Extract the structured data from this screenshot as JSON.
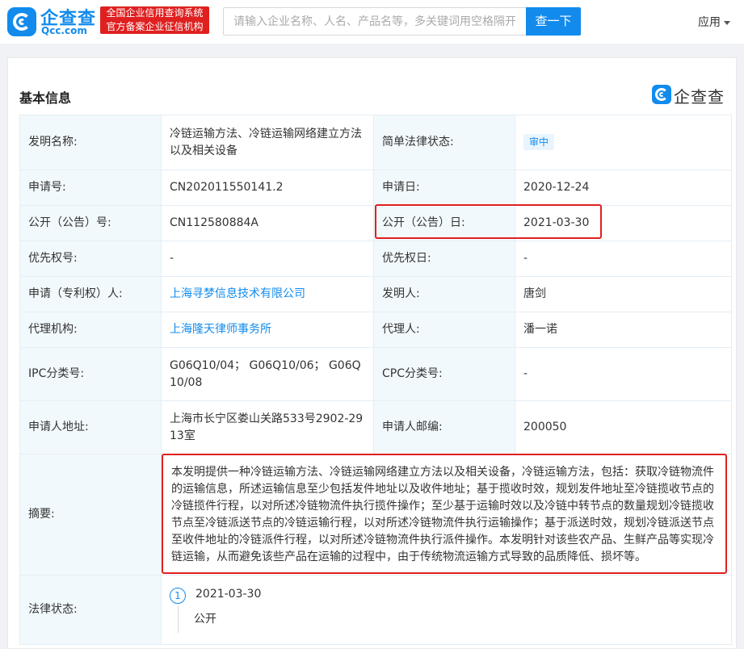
{
  "header": {
    "logo_text": "企查查",
    "logo_sub": "Qcc.com",
    "slogan_line1": "全国企业信用查询系统",
    "slogan_line2": "官方备案企业征信机构",
    "search_placeholder": "请输入企业名称、人名、产品名等，多关键词用空格隔开",
    "search_button": "查一下",
    "apps_label": "应用"
  },
  "section": {
    "title": "基本信息",
    "watermark": "企查查"
  },
  "info": {
    "invention_name_label": "发明名称:",
    "invention_name": "冷链运输方法、冷链运输网络建立方法以及相关设备",
    "legal_status_simple_label": "简单法律状态:",
    "legal_status_simple": "审中",
    "application_no_label": "申请号:",
    "application_no": "CN202011550141.2",
    "application_date_label": "申请日:",
    "application_date": "2020-12-24",
    "publication_no_label": "公开（公告）号:",
    "publication_no": "CN112580884A",
    "publication_date_label": "公开（公告）日:",
    "publication_date": "2021-03-30",
    "priority_no_label": "优先权号:",
    "priority_no": "-",
    "priority_date_label": "优先权日:",
    "priority_date": "-",
    "applicant_label": "申请（专利权）人:",
    "applicant": "上海寻梦信息技术有限公司",
    "inventor_label": "发明人:",
    "inventor": "唐剑",
    "agency_label": "代理机构:",
    "agency": "上海隆天律师事务所",
    "agent_label": "代理人:",
    "agent": "潘一诺",
    "ipc_label": "IPC分类号:",
    "ipc": "G06Q10/04； G06Q10/06； G06Q10/08",
    "cpc_label": "CPC分类号:",
    "cpc": "-",
    "address_label": "申请人地址:",
    "address": "上海市长宁区娄山关路533号2902-2913室",
    "postcode_label": "申请人邮编:",
    "postcode": "200050",
    "abstract_label": "摘要:",
    "abstract": "本发明提供一种冷链运输方法、冷链运输网络建立方法以及相关设备，冷链运输方法，包括：获取冷链物流件的运输信息，所述运输信息至少包括发件地址以及收件地址；基于揽收时效，规划发件地址至冷链揽收节点的冷链揽件行程，以对所述冷链物流件执行揽件操作；至少基于运输时效以及冷链中转节点的数量规划冷链揽收节点至冷链派送节点的冷链运输行程，以对所述冷链物流件执行运输操作；基于派送时效，规划冷链派送节点至收件地址的冷链派件行程，以对所述冷链物流件执行派件操作。本发明针对该些农产品、生鲜产品等实现冷链运输，从而避免该些产品在运输的过程中，由于传统物流运输方式导致的品质降低、损坏等。",
    "legal_status_label": "法律状态:",
    "legal_events": [
      {
        "index": "1",
        "date": "2021-03-30",
        "status": "公开"
      }
    ]
  },
  "colors": {
    "brand": "#128bed",
    "highlight": "#e02020",
    "label_bg": "#f2f9fc"
  }
}
